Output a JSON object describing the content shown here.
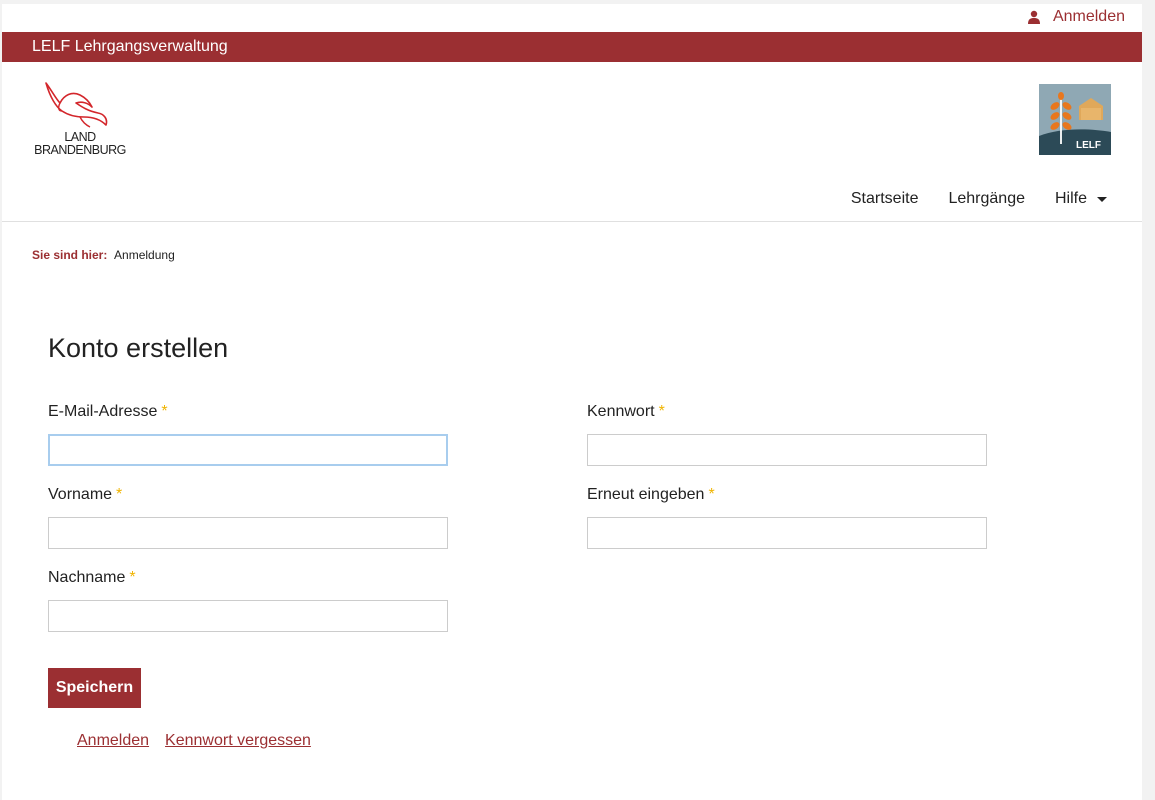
{
  "header": {
    "login_label": "Anmelden",
    "banner_title": "LELF Lehrgangsverwaltung"
  },
  "logos": {
    "brandenburg_line1": "LAND",
    "brandenburg_line2": "BRANDENBURG",
    "lelf_label": "LELF"
  },
  "nav": {
    "items": [
      {
        "label": "Startseite"
      },
      {
        "label": "Lehrgänge"
      },
      {
        "label": "Hilfe"
      }
    ]
  },
  "breadcrumb": {
    "label": "Sie sind hier:",
    "current": "Anmeldung"
  },
  "form": {
    "title": "Konto erstellen",
    "fields": {
      "email": {
        "label": "E-Mail-Adresse",
        "value": ""
      },
      "password": {
        "label": "Kennwort",
        "value": ""
      },
      "firstname": {
        "label": "Vorname",
        "value": ""
      },
      "password_repeat": {
        "label": "Erneut eingeben",
        "value": ""
      },
      "lastname": {
        "label": "Nachname",
        "value": ""
      }
    },
    "required_marker": "*",
    "save_label": "Speichern"
  },
  "footer": {
    "login_link": "Anmelden",
    "forgot_link": "Kennwort vergessen"
  },
  "colors": {
    "brand": "#9b2f32",
    "required": "#f0b400",
    "focus": "#a8cdee"
  }
}
